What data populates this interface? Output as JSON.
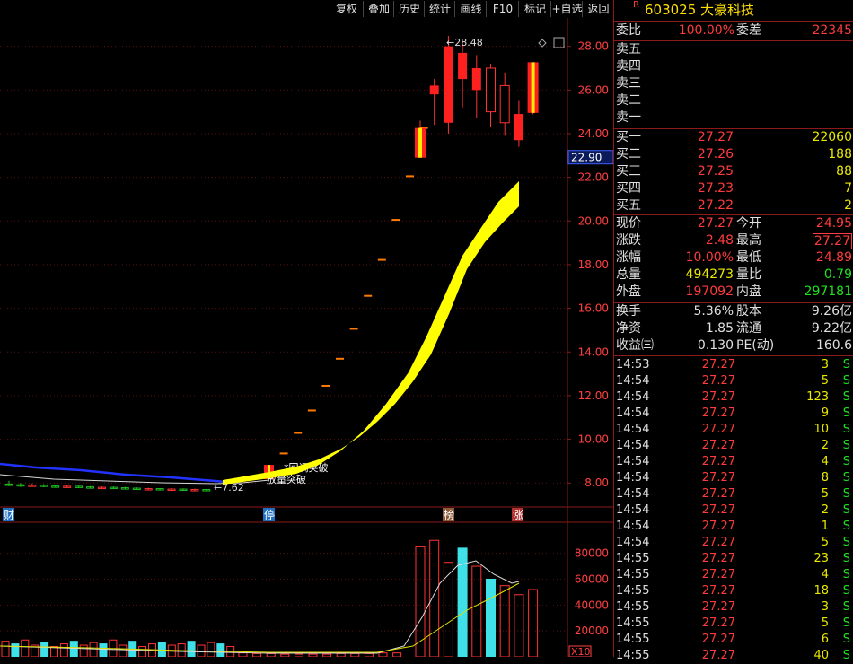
{
  "toolbar": {
    "buttons": [
      "复权",
      "叠加",
      "历史",
      "统计",
      "画线",
      "F10",
      "标记",
      "+自选",
      "返回"
    ]
  },
  "stock": {
    "flag": "R",
    "code_name": "603025 大豪科技"
  },
  "weibi": {
    "label": "委比",
    "value": "100.00%",
    "label2": "委差",
    "value2": "22345"
  },
  "asks": [
    {
      "label": "卖五"
    },
    {
      "label": "卖四"
    },
    {
      "label": "卖三"
    },
    {
      "label": "卖二"
    },
    {
      "label": "卖一"
    }
  ],
  "bids": [
    {
      "label": "买一",
      "price": "27.27",
      "vol": "22060"
    },
    {
      "label": "买二",
      "price": "27.26",
      "vol": "188"
    },
    {
      "label": "买三",
      "price": "27.25",
      "vol": "88"
    },
    {
      "label": "买四",
      "price": "27.23",
      "vol": "7"
    },
    {
      "label": "买五",
      "price": "27.22",
      "vol": "2"
    }
  ],
  "quote": {
    "xianjia": {
      "label": "现价",
      "value": "27.27"
    },
    "jinkai": {
      "label": "今开",
      "value": "24.95"
    },
    "zhangdie": {
      "label": "涨跌",
      "value": "2.48"
    },
    "zuigao": {
      "label": "最高",
      "value": "27.27"
    },
    "zhangfu": {
      "label": "涨幅",
      "value": "10.00%"
    },
    "zuidi": {
      "label": "最低",
      "value": "24.89"
    },
    "zongliang": {
      "label": "总量",
      "value": "494273"
    },
    "liangbi": {
      "label": "量比",
      "value": "0.79"
    },
    "waipan": {
      "label": "外盘",
      "value": "197092"
    },
    "neipan": {
      "label": "内盘",
      "value": "297181"
    }
  },
  "finance": {
    "huanshou": {
      "label": "换手",
      "value": "5.36%"
    },
    "guben": {
      "label": "股本",
      "value": "9.26亿"
    },
    "jingzi": {
      "label": "净资",
      "value": "1.85"
    },
    "liutong": {
      "label": "流通",
      "value": "9.22亿"
    },
    "shouyi": {
      "label": "收益㈢",
      "value": "0.130"
    },
    "pe": {
      "label": "PE(动)",
      "value": "160.6"
    }
  },
  "ticks": [
    [
      "14:53",
      "27.27",
      "3",
      "S"
    ],
    [
      "14:54",
      "27.27",
      "5",
      "S"
    ],
    [
      "14:54",
      "27.27",
      "123",
      "S"
    ],
    [
      "14:54",
      "27.27",
      "9",
      "S"
    ],
    [
      "14:54",
      "27.27",
      "10",
      "S"
    ],
    [
      "14:54",
      "27.27",
      "2",
      "S"
    ],
    [
      "14:54",
      "27.27",
      "4",
      "S"
    ],
    [
      "14:54",
      "27.27",
      "8",
      "S"
    ],
    [
      "14:54",
      "27.27",
      "5",
      "S"
    ],
    [
      "14:54",
      "27.27",
      "2",
      "S"
    ],
    [
      "14:54",
      "27.27",
      "1",
      "S"
    ],
    [
      "14:54",
      "27.27",
      "5",
      "S"
    ],
    [
      "14:55",
      "27.27",
      "23",
      "S"
    ],
    [
      "14:55",
      "27.27",
      "4",
      "S"
    ],
    [
      "14:55",
      "27.27",
      "18",
      "S"
    ],
    [
      "14:55",
      "27.27",
      "3",
      "S"
    ],
    [
      "14:55",
      "27.27",
      "5",
      "S"
    ],
    [
      "14:55",
      "27.27",
      "6",
      "S"
    ],
    [
      "14:55",
      "27.27",
      "40",
      "S"
    ]
  ],
  "chart_data": {
    "type": "candlestick",
    "price_axis": {
      "ticks": [
        8,
        10,
        12,
        14,
        16,
        18,
        20,
        22,
        24,
        26,
        28
      ],
      "labels": [
        "8.00",
        "10.00",
        "12.00",
        "14.00",
        "16.00",
        "18.00",
        "20.00",
        "22.00",
        "24.00",
        "26.00",
        "28.00"
      ],
      "range": [
        6.9,
        29.3
      ]
    },
    "current_price_marker": "22.90",
    "annotations": {
      "high_label": "28.48",
      "low_label": "7.62",
      "signal_1": "*回调突破",
      "signal_2": "放量突破"
    },
    "event_markers": [
      "财",
      "停",
      "榜",
      "涨"
    ],
    "volume_axis": {
      "ticks": [
        20000,
        40000,
        60000,
        80000
      ],
      "labels": [
        "20000",
        "40000",
        "60000",
        "80000"
      ],
      "range": [
        0,
        95000
      ],
      "unit": "X10"
    },
    "accent_colors": {
      "up": "#ff3333",
      "down": "#20c020",
      "ribbon": "#ffff00",
      "ma_blue": "#2020ff",
      "volume_up_fill": "#40e0e8"
    },
    "candles_pre": [
      [
        7.95,
        7.92,
        8.1,
        7.85
      ],
      [
        7.92,
        7.9,
        8.0,
        7.82
      ],
      [
        7.9,
        7.9,
        7.98,
        7.84
      ],
      [
        7.9,
        7.86,
        7.95,
        7.8
      ],
      [
        7.86,
        7.84,
        7.92,
        7.78
      ],
      [
        7.84,
        7.85,
        7.9,
        7.8
      ],
      [
        7.85,
        7.82,
        7.88,
        7.76
      ],
      [
        7.82,
        7.8,
        7.86,
        7.74
      ],
      [
        7.8,
        7.8,
        7.84,
        7.75
      ],
      [
        7.8,
        7.78,
        7.84,
        7.72
      ],
      [
        7.78,
        7.76,
        7.82,
        7.7
      ],
      [
        7.76,
        7.74,
        7.8,
        7.68
      ],
      [
        7.74,
        7.74,
        7.78,
        7.7
      ],
      [
        7.74,
        7.72,
        7.76,
        7.66
      ],
      [
        7.72,
        7.72,
        7.76,
        7.68
      ],
      [
        7.72,
        7.7,
        7.75,
        7.64
      ],
      [
        7.7,
        7.7,
        7.74,
        7.65
      ],
      [
        7.7,
        7.68,
        7.72,
        7.62
      ]
    ],
    "limit_up_days": [
      8.5,
      9.35,
      10.29,
      11.32,
      12.45,
      13.69,
      15.06,
      16.57,
      18.22,
      20.05,
      22.05,
      24.26
    ],
    "candles_late": [
      [
        24.26,
        22.9,
        24.6,
        22.9
      ],
      [
        25.8,
        26.2,
        26.5,
        24.4
      ],
      [
        24.5,
        28.0,
        28.48,
        24.0
      ],
      [
        26.5,
        27.7,
        28.2,
        25.2
      ],
      [
        26.0,
        27.0,
        27.6,
        24.7
      ],
      [
        27.0,
        25.0,
        27.2,
        24.3
      ],
      [
        26.2,
        24.5,
        26.8,
        23.9
      ],
      [
        23.7,
        24.9,
        25.5,
        23.4
      ],
      [
        24.95,
        27.27,
        27.27,
        24.89
      ]
    ],
    "volume_pre": [
      12000,
      10000,
      13000,
      9000,
      11000,
      8000,
      10000,
      12000,
      9000,
      11000,
      10000,
      13000,
      9000,
      12000,
      8000,
      10000,
      11000,
      9000,
      10000,
      12000,
      9000,
      11000,
      10000,
      8000
    ],
    "volume_mid": [
      3000,
      2500,
      2500,
      2000,
      2000,
      2000,
      2000,
      2500,
      2500,
      2500,
      3000,
      3000
    ],
    "volume_late": [
      85000,
      90000,
      73000,
      84000,
      70000,
      60000,
      55000,
      48000,
      52000
    ]
  }
}
